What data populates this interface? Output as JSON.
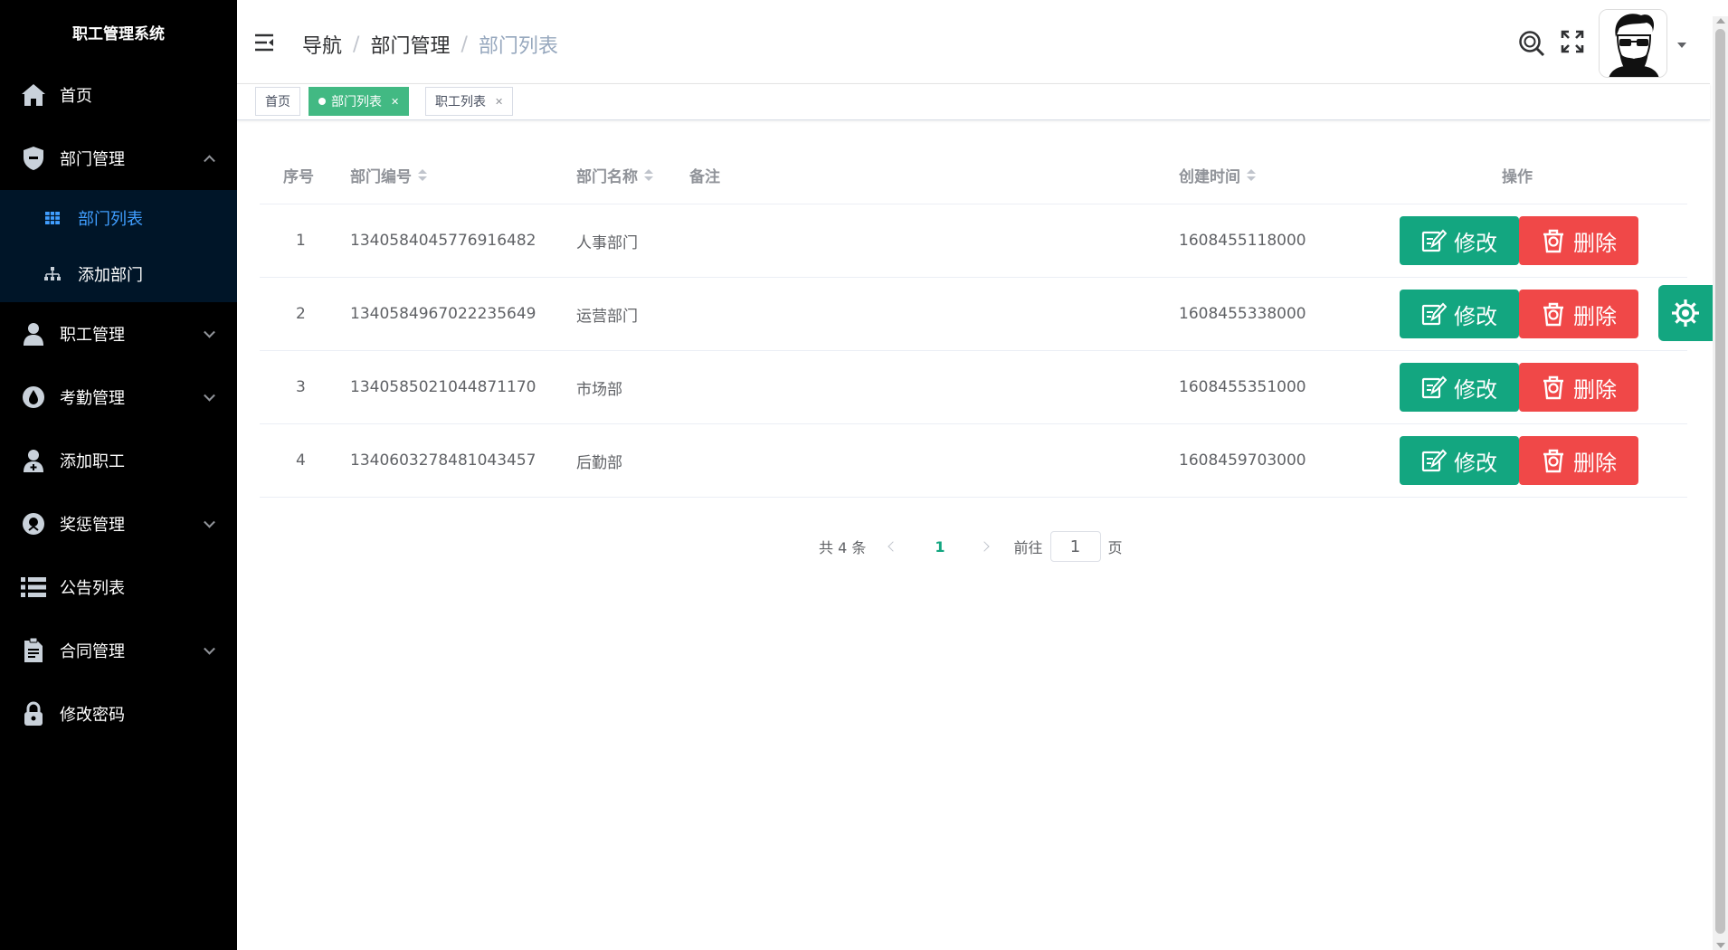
{
  "app": {
    "title": "职工管理系统"
  },
  "sidebar": {
    "items": [
      {
        "label": "首页",
        "icon": "home-icon"
      },
      {
        "label": "部门管理",
        "icon": "shield-icon",
        "expanded": true,
        "children": [
          {
            "label": "部门列表",
            "icon": "table-icon",
            "active": true
          },
          {
            "label": "添加部门",
            "icon": "org-chart-icon"
          }
        ]
      },
      {
        "label": "职工管理",
        "icon": "user-icon"
      },
      {
        "label": "考勤管理",
        "icon": "drop-icon"
      },
      {
        "label": "添加职工",
        "icon": "user-add-icon"
      },
      {
        "label": "奖惩管理",
        "icon": "award-icon"
      },
      {
        "label": "公告列表",
        "icon": "list-icon"
      },
      {
        "label": "合同管理",
        "icon": "document-icon"
      },
      {
        "label": "修改密码",
        "icon": "lock-icon"
      }
    ]
  },
  "header": {
    "breadcrumb": [
      "导航",
      "部门管理",
      "部门列表"
    ]
  },
  "tags": [
    {
      "label": "首页",
      "active": false,
      "closable": false
    },
    {
      "label": "部门列表",
      "active": true,
      "closable": true
    },
    {
      "label": "职工列表",
      "active": false,
      "closable": true
    }
  ],
  "table": {
    "columns": [
      "序号",
      "部门编号",
      "部门名称",
      "备注",
      "创建时间",
      "操作"
    ],
    "rows": [
      {
        "index": "1",
        "id": "1340584045776916482",
        "name": "人事部门",
        "note": "",
        "created": "1608455118000"
      },
      {
        "index": "2",
        "id": "1340584967022235649",
        "name": "运营部门",
        "note": "",
        "created": "1608455338000"
      },
      {
        "index": "3",
        "id": "1340585021044871170",
        "name": "市场部",
        "note": "",
        "created": "1608455351000"
      },
      {
        "index": "4",
        "id": "1340603278481043457",
        "name": "后勤部",
        "note": "",
        "created": "1608459703000"
      }
    ],
    "actions": {
      "edit": "修改",
      "delete": "删除"
    }
  },
  "pagination": {
    "total_text": "共 4 条",
    "current_page": "1",
    "goto_label": "前往",
    "goto_value": "1",
    "page_suffix": "页"
  },
  "colors": {
    "sidebar_bg": "#000000",
    "submenu_bg": "#001528",
    "active_link": "#409eff",
    "primary_green": "#13a680",
    "tag_green": "#42b983",
    "danger_red": "#f04848"
  }
}
